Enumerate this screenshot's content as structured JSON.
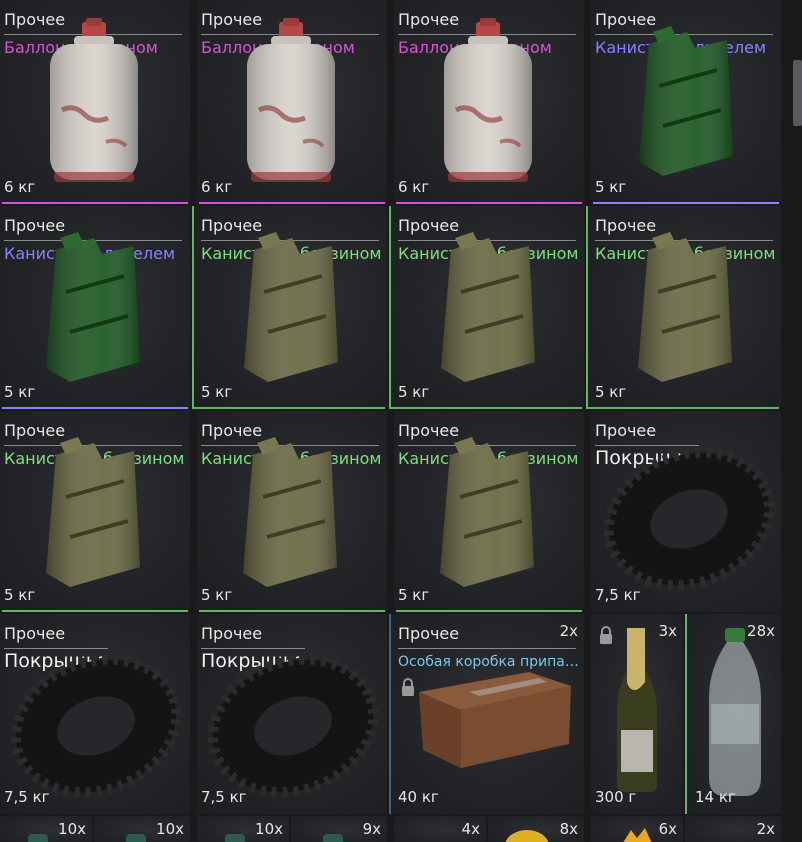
{
  "colors": {
    "methane": "#d455d4",
    "diesel": "#8a82ff",
    "petrol": "#7fe07f",
    "special": "#7cc8e8",
    "tire": "#f2f2f2",
    "bar_green": "#5fb85f"
  },
  "row1": [
    {
      "category": "Прочее",
      "name": "Баллон с метаном",
      "weight": "6 кг",
      "icon": "gas-cylinder"
    },
    {
      "category": "Прочее",
      "name": "Баллон с метаном",
      "weight": "6 кг",
      "icon": "gas-cylinder"
    },
    {
      "category": "Прочее",
      "name": "Баллон с метаном",
      "weight": "6 кг",
      "icon": "gas-cylinder"
    },
    {
      "category": "Прочее",
      "name": "Канистра с дизелем",
      "weight": "5 кг",
      "icon": "jerrycan-green"
    }
  ],
  "row2": [
    {
      "category": "Прочее",
      "name": "Канистра с дизелем",
      "weight": "5 кг",
      "icon": "jerrycan-green"
    },
    {
      "category": "Прочее",
      "name": "Канистра с бензином",
      "weight": "5 кг",
      "icon": "jerrycan-olive"
    },
    {
      "category": "Прочее",
      "name": "Канистра с бензином",
      "weight": "5 кг",
      "icon": "jerrycan-olive"
    },
    {
      "category": "Прочее",
      "name": "Канистра с бензином",
      "weight": "5 кг",
      "icon": "jerrycan-olive"
    }
  ],
  "row3": [
    {
      "category": "Прочее",
      "name": "Канистра с бензином",
      "weight": "5 кг",
      "icon": "jerrycan-olive"
    },
    {
      "category": "Прочее",
      "name": "Канистра с бензином",
      "weight": "5 кг",
      "icon": "jerrycan-olive"
    },
    {
      "category": "Прочее",
      "name": "Канистра с бензином",
      "weight": "5 кг",
      "icon": "jerrycan-olive"
    },
    {
      "category": "Прочее",
      "name": "Покрышка",
      "weight": "7,5 кг",
      "icon": "tire"
    }
  ],
  "row4": [
    {
      "category": "Прочее",
      "name": "Покрышка",
      "weight": "7,5 кг",
      "icon": "tire"
    },
    {
      "category": "Прочее",
      "name": "Покрышка",
      "weight": "7,5 кг",
      "icon": "tire"
    },
    {
      "category": "Прочее",
      "name": "Особая коробка припас..",
      "weight": "40 кг",
      "count": "2x",
      "icon": "cardboard-box",
      "locked": true
    },
    {
      "count": "3x",
      "weight": "300 г",
      "icon": "champagne-bottle",
      "locked": true
    },
    {
      "count": "28x",
      "weight": "14 кг",
      "icon": "water-bottle"
    }
  ],
  "row5": [
    {
      "count": "10x"
    },
    {
      "count": "10x"
    },
    {
      "count": "10x"
    },
    {
      "count": "9x"
    },
    {
      "count": "4x"
    },
    {
      "count": "8x"
    },
    {
      "count": "6x"
    },
    {
      "count": "2x"
    }
  ]
}
